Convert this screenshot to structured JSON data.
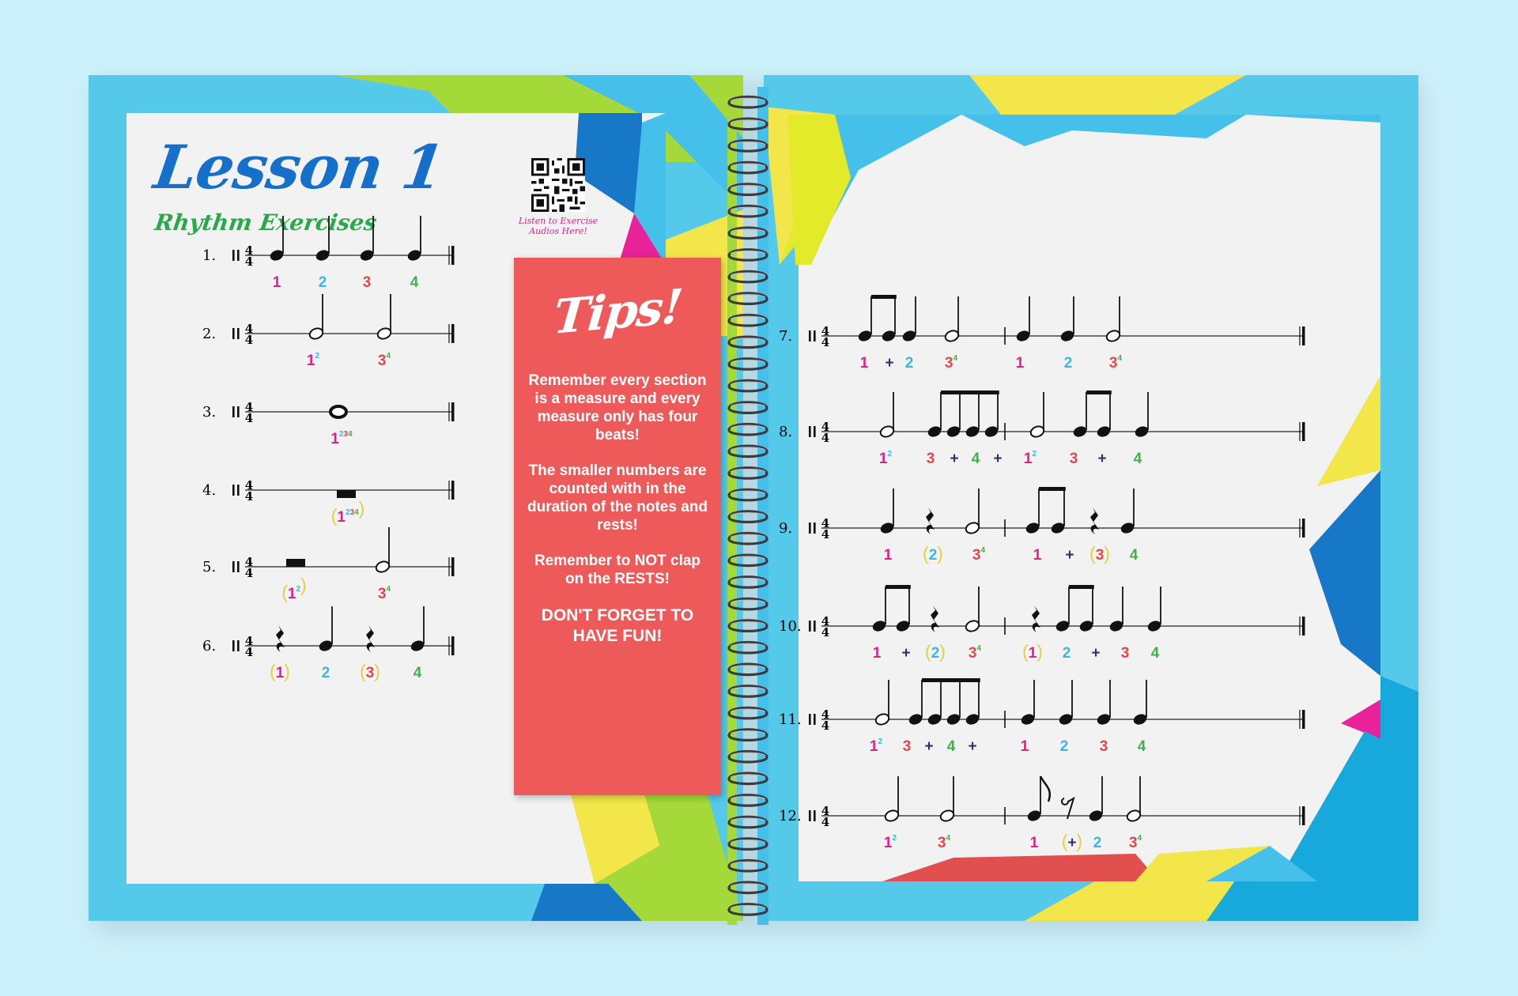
{
  "lesson": {
    "title": "Lesson 1",
    "subtitle": "Rhythm Exercises",
    "qr_caption_1": "Listen to Exercise",
    "qr_caption_2": "Audios Here!"
  },
  "tips": {
    "title": "Tips!",
    "items": [
      "Remember every section is a measure and every measure only has four beats!",
      "The smaller numbers are counted with in the duration of the notes and rests!",
      "Remember to NOT clap on the RESTS!",
      "DON'T FORGET TO HAVE FUN!"
    ]
  },
  "colors": {
    "beat1": "#e31e8c",
    "beat2": "#3bb6e3",
    "beat3": "#e2474b",
    "beat4": "#3fb14b",
    "and": "#3c2a6e",
    "paren": "#e8cf3c",
    "tips_bg": "#ee5a5a",
    "title": "#1670c9",
    "subtitle": "#2aa84a"
  },
  "time_signature": {
    "top": "4",
    "bottom": "4"
  },
  "exercises": [
    {
      "label": "1.",
      "counts": [
        {
          "text": "1",
          "color": "beat1"
        },
        {
          "text": "2",
          "color": "beat2"
        },
        {
          "text": "3",
          "color": "beat3"
        },
        {
          "text": "4",
          "color": "beat4"
        }
      ]
    },
    {
      "label": "2.",
      "counts": [
        {
          "text": "1",
          "sup": "2",
          "color": "beat1"
        },
        {
          "text": "3",
          "sup": "4",
          "color": "beat3"
        }
      ]
    },
    {
      "label": "3.",
      "counts": [
        {
          "text": "1",
          "sup": "234",
          "color": "beat1"
        }
      ]
    },
    {
      "label": "4.",
      "counts": [
        {
          "text": "1",
          "sup": "234",
          "color": "beat1",
          "paren": true
        }
      ]
    },
    {
      "label": "5.",
      "counts": [
        {
          "text": "1",
          "sup": "2",
          "color": "beat1",
          "paren": true
        },
        {
          "text": "3",
          "sup": "4",
          "color": "beat3"
        }
      ]
    },
    {
      "label": "6.",
      "counts": [
        {
          "text": "1",
          "color": "beat1",
          "paren": true
        },
        {
          "text": "2",
          "color": "beat2"
        },
        {
          "text": "3",
          "color": "beat3",
          "paren": true
        },
        {
          "text": "4",
          "color": "beat4"
        }
      ]
    },
    {
      "label": "7.",
      "counts": [
        {
          "text": "1",
          "color": "beat1"
        },
        {
          "text": "+",
          "color": "and"
        },
        {
          "text": "2",
          "color": "beat2"
        },
        {
          "text": "3",
          "sup": "4",
          "color": "beat3"
        },
        {
          "text": "1",
          "color": "beat1"
        },
        {
          "text": "2",
          "color": "beat2"
        },
        {
          "text": "3",
          "sup": "4",
          "color": "beat3"
        }
      ]
    },
    {
      "label": "8.",
      "counts": [
        {
          "text": "1",
          "sup": "2",
          "color": "beat1"
        },
        {
          "text": "3",
          "color": "beat3"
        },
        {
          "text": "+",
          "color": "and"
        },
        {
          "text": "4",
          "color": "beat4"
        },
        {
          "text": "+",
          "color": "and"
        },
        {
          "text": "1",
          "sup": "2",
          "color": "beat1"
        },
        {
          "text": "3",
          "color": "beat3"
        },
        {
          "text": "+",
          "color": "and"
        },
        {
          "text": "4",
          "color": "beat4"
        }
      ]
    },
    {
      "label": "9.",
      "counts": [
        {
          "text": "1",
          "color": "beat1"
        },
        {
          "text": "2",
          "color": "beat2",
          "paren": true
        },
        {
          "text": "3",
          "sup": "4",
          "color": "beat3"
        },
        {
          "text": "1",
          "color": "beat1"
        },
        {
          "text": "+",
          "color": "and"
        },
        {
          "text": "3",
          "color": "beat3",
          "paren": true
        },
        {
          "text": "4",
          "color": "beat4"
        }
      ]
    },
    {
      "label": "10.",
      "counts": [
        {
          "text": "1",
          "color": "beat1"
        },
        {
          "text": "+",
          "color": "and"
        },
        {
          "text": "2",
          "color": "beat2",
          "paren": true
        },
        {
          "text": "3",
          "sup": "4",
          "color": "beat3"
        },
        {
          "text": "1",
          "color": "beat1",
          "paren": true
        },
        {
          "text": "2",
          "color": "beat2"
        },
        {
          "text": "+",
          "color": "and"
        },
        {
          "text": "3",
          "color": "beat3"
        },
        {
          "text": "4",
          "color": "beat4"
        }
      ]
    },
    {
      "label": "11.",
      "counts": [
        {
          "text": "1",
          "sup": "2",
          "color": "beat1"
        },
        {
          "text": "3",
          "color": "beat3"
        },
        {
          "text": "+",
          "color": "and"
        },
        {
          "text": "4",
          "color": "beat4"
        },
        {
          "text": "+",
          "color": "and"
        },
        {
          "text": "1",
          "color": "beat1"
        },
        {
          "text": "2",
          "color": "beat2"
        },
        {
          "text": "3",
          "color": "beat3"
        },
        {
          "text": "4",
          "color": "beat4"
        }
      ]
    },
    {
      "label": "12.",
      "counts": [
        {
          "text": "1",
          "sup": "2",
          "color": "beat1"
        },
        {
          "text": "3",
          "sup": "4",
          "color": "beat3"
        },
        {
          "text": "1",
          "color": "beat1"
        },
        {
          "text": "+",
          "color": "and",
          "paren": true
        },
        {
          "text": "2",
          "color": "beat2"
        },
        {
          "text": "3",
          "sup": "4",
          "color": "beat3"
        }
      ]
    }
  ]
}
